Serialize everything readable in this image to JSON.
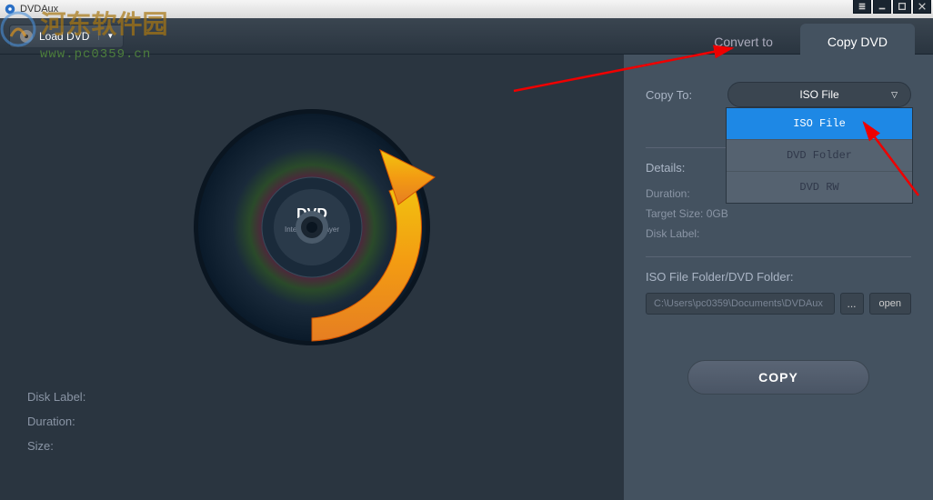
{
  "app": {
    "title": "DVDAux"
  },
  "toolbar": {
    "load_label": "Load DVD"
  },
  "tabs": {
    "convert": "Convert to",
    "copy": "Copy DVD"
  },
  "disc": {
    "label": "DVD",
    "sublabel": "Inter DVD Player"
  },
  "left": {
    "disk_label": "Disk Label:",
    "duration": "Duration:",
    "size": "Size:"
  },
  "right": {
    "copy_to_label": "Copy To:",
    "selected": "ISO File",
    "options": [
      "ISO File",
      "DVD Folder",
      "DVD RW"
    ],
    "details_label": "Details:",
    "duration_label": "Duration:",
    "target_size_label": "Target Size:",
    "target_size_value": "0GB",
    "disk_label_label": "Disk Label:",
    "iso_folder_label": "ISO File Folder/DVD Folder:",
    "path_value": "C:\\Users\\pc0359\\Documents\\DVDAux",
    "browse_label": "...",
    "open_label": "open",
    "copy_label": "COPY"
  },
  "watermark": {
    "text1": "河东软件园",
    "text2": "www.pc0359.cn"
  }
}
